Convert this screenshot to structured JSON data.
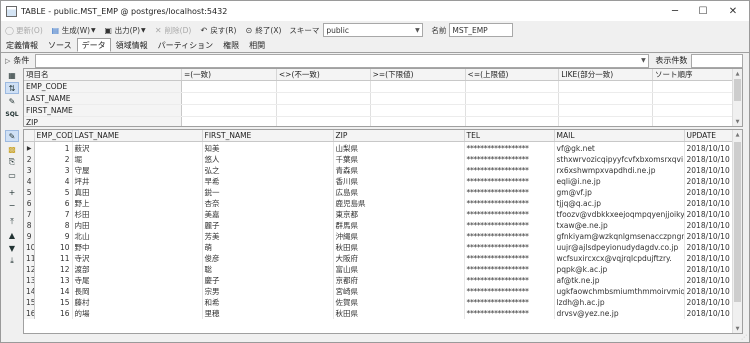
{
  "window": {
    "title": "TABLE - public.MST_EMP @ postgres/localhost:5432",
    "minimize": "─",
    "maximize": "☐",
    "close": "✕"
  },
  "toolbar": {
    "update_label": "更新(O)",
    "generate_label": "生成(W)",
    "output_label": "出力(P)",
    "delete_label": "削除(D)",
    "back_label": "戻す(R)",
    "finish_label": "終了(X)",
    "schema_label": "スキーマ",
    "schema_value": "public",
    "name_label": "名前",
    "name_value": "MST_EMP"
  },
  "tabs": [
    "定義情報",
    "ソース",
    "データ",
    "領域情報",
    "パーティション",
    "権限",
    "相関"
  ],
  "active_tab_index": 2,
  "condition": {
    "label": "条件",
    "value": "",
    "display_count_label": "表示件数",
    "display_count_value": ""
  },
  "filter_grid": {
    "headers": [
      "項目名",
      "=(一致)",
      "<>(不一致)",
      ">=(下限値)",
      "<=(上限値)",
      "LIKE(部分一致)",
      "ソート順序"
    ],
    "rows": [
      "EMP_CODE",
      "LAST_NAME",
      "FIRST_NAME",
      "ZIP"
    ]
  },
  "data_grid": {
    "headers": [
      "EMP_CODE",
      "LAST_NAME",
      "FIRST_NAME",
      "ZIP",
      "TEL",
      "MAIL",
      "UPDATE"
    ],
    "rows": [
      {
        "rn": "",
        "code": "1",
        "last": "薮沢",
        "first": "知美",
        "zip": "山梨県",
        "tel": "******************",
        "mail": "vf@gk.net",
        "upd": "2018/10/10"
      },
      {
        "rn": "2",
        "code": "2",
        "last": "堀",
        "first": "悠人",
        "zip": "千葉県",
        "tel": "******************",
        "mail": "sthxwrvozicqipyyfcvfxbxomsrxqvi",
        "upd": "2018/10/10"
      },
      {
        "rn": "3",
        "code": "3",
        "last": "守屋",
        "first": "弘之",
        "zip": "青森県",
        "tel": "******************",
        "mail": "rx6xshwmpxvapdhdi.ne.jp",
        "upd": "2018/10/10"
      },
      {
        "rn": "4",
        "code": "4",
        "last": "坪井",
        "first": "早希",
        "zip": "香川県",
        "tel": "******************",
        "mail": "eqli@i.ne.jp",
        "upd": "2018/10/10"
      },
      {
        "rn": "5",
        "code": "5",
        "last": "真田",
        "first": "鋭一",
        "zip": "広島県",
        "tel": "******************",
        "mail": "gm@vf.jp",
        "upd": "2018/10/10"
      },
      {
        "rn": "6",
        "code": "6",
        "last": "野上",
        "first": "杏奈",
        "zip": "鹿児島県",
        "tel": "******************",
        "mail": "tjjq@q.ac.jp",
        "upd": "2018/10/10"
      },
      {
        "rn": "7",
        "code": "7",
        "last": "杉田",
        "first": "美嘉",
        "zip": "東京都",
        "tel": "******************",
        "mail": "tfoozv@vdbkkxeejoqmpqyenjjoiky",
        "upd": "2018/10/10"
      },
      {
        "rn": "8",
        "code": "8",
        "last": "内田",
        "first": "麗子",
        "zip": "群馬県",
        "tel": "******************",
        "mail": "txaw@e.ne.jp",
        "upd": "2018/10/10"
      },
      {
        "rn": "9",
        "code": "9",
        "last": "北山",
        "first": "芳美",
        "zip": "沖縄県",
        "tel": "******************",
        "mail": "gfnkiyam@wzkqnlgmsenacczpngnfl",
        "upd": "2018/10/10"
      },
      {
        "rn": "10",
        "code": "10",
        "last": "野中",
        "first": "萌",
        "zip": "秋田県",
        "tel": "******************",
        "mail": "uujr@ajlsdpeyionudydagdv.co.jp",
        "upd": "2018/10/10"
      },
      {
        "rn": "11",
        "code": "11",
        "last": "寺沢",
        "first": "俊彦",
        "zip": "大阪府",
        "tel": "******************",
        "mail": "wcfsuxircxcx@vqjrqlcpdujftzry.",
        "upd": "2018/10/10"
      },
      {
        "rn": "12",
        "code": "12",
        "last": "渡部",
        "first": "聡",
        "zip": "富山県",
        "tel": "******************",
        "mail": "pqpk@k.ac.jp",
        "upd": "2018/10/10"
      },
      {
        "rn": "13",
        "code": "13",
        "last": "寺尾",
        "first": "慶子",
        "zip": "京都府",
        "tel": "******************",
        "mail": "af@tk.ne.jp",
        "upd": "2018/10/10"
      },
      {
        "rn": "14",
        "code": "14",
        "last": "長岡",
        "first": "宗男",
        "zip": "宮崎県",
        "tel": "******************",
        "mail": "ugkfaowchmbsmiumthmmoirvmiqtne",
        "upd": "2018/10/10"
      },
      {
        "rn": "15",
        "code": "15",
        "last": "藤村",
        "first": "和希",
        "zip": "佐賀県",
        "tel": "******************",
        "mail": "lzdh@h.ac.jp",
        "upd": "2018/10/10"
      },
      {
        "rn": "16",
        "code": "16",
        "last": "的場",
        "first": "里穂",
        "zip": "秋田県",
        "tel": "******************",
        "mail": "drvsv@yez.ne.jp",
        "upd": "2018/10/10"
      }
    ]
  }
}
